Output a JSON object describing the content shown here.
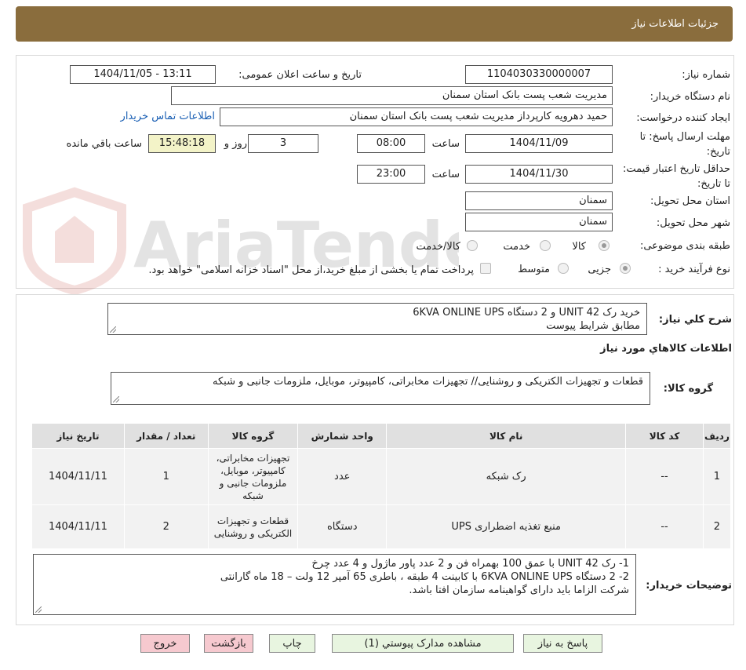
{
  "header": {
    "title": "جزئیات اطلاعات نیاز"
  },
  "watermark": {
    "text": "AriaTender.neT"
  },
  "form": {
    "need_number_label": "شماره نیاز:",
    "need_number": "1104030330000007",
    "announce_label": "تاریخ و ساعت اعلان عمومی:",
    "announce_value": "1404/11/05 - 13:11",
    "buyer_org_label": "نام دستگاه خریدار:",
    "buyer_org": "مدیریت شعب پست بانک استان سمنان",
    "requester_label": "ایجاد کننده درخواست:",
    "requester": "حمید دهرویه کارپرداز مدیریت شعب پست بانک استان سمنان",
    "contact_link": "اطلاعات تماس خریدار",
    "deadline_label": "مهلت ارسال پاسخ: تا تاریخ:",
    "deadline_date": "1404/11/09",
    "time_label": "ساعت",
    "deadline_time": "08:00",
    "days_value": "3",
    "days_label": "روز و",
    "remaining_value": "15:48:18",
    "remaining_label": "ساعت باقي مانده",
    "validity_label": "حداقل تاریخ اعتبار قیمت: تا تاریخ:",
    "validity_date": "1404/11/30",
    "validity_time": "23:00",
    "province_label": "استان محل تحویل:",
    "province": "سمنان",
    "city_label": "شهر محل تحویل:",
    "city": "سمنان",
    "category_label": "طبقه بندی موضوعی:",
    "category_options": [
      "کالا",
      "خدمت",
      "کالا/خدمت"
    ],
    "process_label": "نوع فرآیند خرید :",
    "process_options": [
      "جزیی",
      "متوسط"
    ],
    "payment_note": "پرداخت تمام یا بخشی از مبلغ خرید،از محل \"اسناد خزانه اسلامی\" خواهد بود."
  },
  "summary": {
    "label": "شرح کلي نياز:",
    "line1": "خرید  رک  UNIT 42 و 2 دستگاه  6KVA  ONLINE UPS",
    "line2": "مطابق شرایط پیوست"
  },
  "goods": {
    "section_title": "اطلاعات کالاهاي مورد نياز",
    "group_label": "گروه کالا:",
    "group_value": "قطعات و تجهیزات الکتریکی و روشنایی// تجهیزات مخابراتی، کامپیوتر، موبایل، ملزومات جانبی و شبکه"
  },
  "table": {
    "headers": [
      "رديف",
      "کد کالا",
      "نام کالا",
      "واحد شمارش",
      "گروه کالا",
      "تعداد / مقدار",
      "تاریخ نیاز"
    ],
    "rows": [
      [
        "1",
        "--",
        "رک شبکه",
        "عدد",
        "تجهیزات مخابراتی، کامپیوتر، موبایل، ملزومات جانبی و شبکه",
        "1",
        "1404/11/11"
      ],
      [
        "2",
        "--",
        "منبع تغذیه اضطراری UPS",
        "دستگاه",
        "قطعات و تجهیزات الکتریکی و روشنایی",
        "2",
        "1404/11/11"
      ]
    ]
  },
  "notes": {
    "label": "توضیحات خریدار:",
    "line1": "1-    رک  UNIT 42 با عمق 100 بهمراه فن و 2 عدد پاور ماژول و 4 عدد چرخ",
    "line2": "2-    2 دستگاه  6KVA  ONLINE UPS با کابینت 4 طبقه ،  باطری 65 آمپر 12 ولت – 18 ماه گارانتی",
    "line3": "شرکت الزاما  باید دارای گواهینامه سازمان افتا باشد."
  },
  "buttons": {
    "respond": "پاسخ به نیاز",
    "attachments": "مشاهده مدارک پیوستي (1)",
    "print": "چاپ",
    "back": "بازگشت",
    "exit": "خروج"
  }
}
